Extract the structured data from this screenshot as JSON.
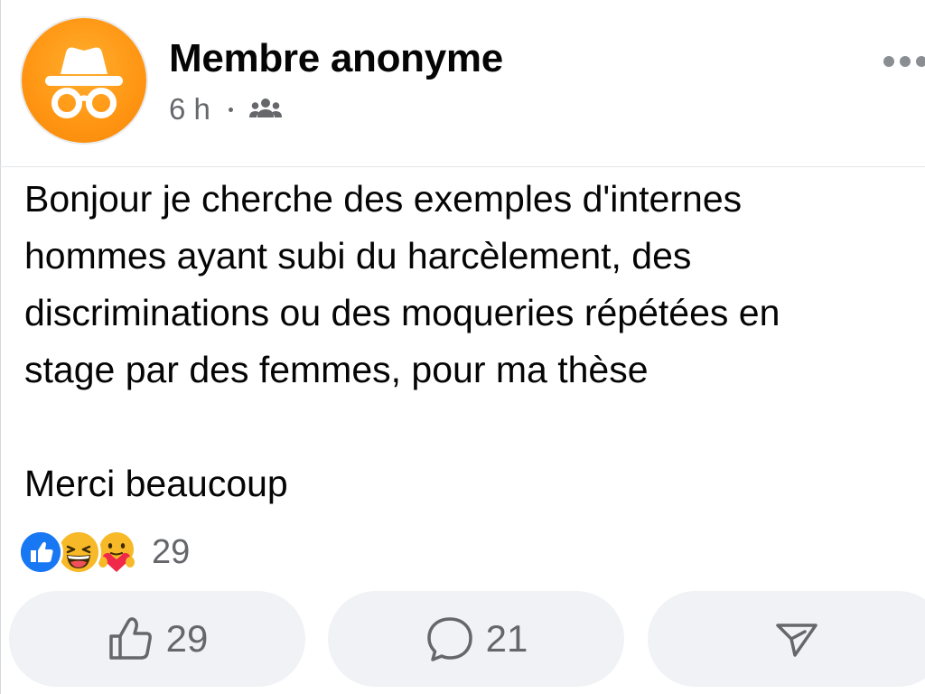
{
  "post": {
    "author": "Membre anonyme",
    "time": "6 h",
    "audience_icon": "group-icon",
    "avatar_icon": "incognito-icon",
    "body": "Bonjour je cherche des exemples d'internes\nhommes ayant subi du harcèlement, des\ndiscriminations ou des moqueries répétées en\nstage par des femmes, pour ma thèse\n\nMerci beaucoup",
    "menu_icon": "more-options-icon"
  },
  "reactions": {
    "icons": [
      "like-reaction-icon",
      "haha-reaction-icon",
      "care-reaction-icon"
    ],
    "count": "29"
  },
  "actions": {
    "like": {
      "icon": "thumbs-up-icon",
      "count": "29"
    },
    "comment": {
      "icon": "comment-bubble-icon",
      "count": "21"
    },
    "share": {
      "icon": "send-icon"
    }
  },
  "colors": {
    "avatar_bg": "#ff9512",
    "like_blue": "#1877f2",
    "haha_yellow": "#f7b928",
    "text_primary": "#050505",
    "text_secondary": "#65676b",
    "button_bg": "#f0f2f5"
  }
}
